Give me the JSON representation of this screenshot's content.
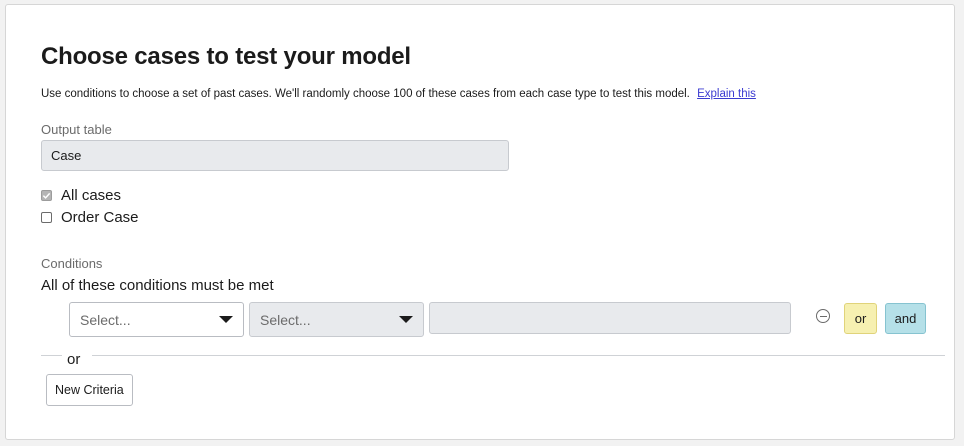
{
  "page": {
    "title": "Choose cases to test your model",
    "description": "Use conditions to choose a set of past cases. We'll randomly choose 100 of these cases from each case type to test this model.",
    "explain_link": "Explain this"
  },
  "output_table": {
    "label": "Output table",
    "value": "Case"
  },
  "case_types": [
    {
      "label": "All cases",
      "checked": true
    },
    {
      "label": "Order Case",
      "checked": false
    }
  ],
  "conditions": {
    "label": "Conditions",
    "heading": "All of these conditions must be met",
    "row": {
      "field_select": "Select...",
      "operator_select": "Select...",
      "value": ""
    },
    "or_button": "or",
    "and_button": "and",
    "or_separator": "or",
    "new_criteria_button": "New Criteria"
  },
  "colors": {
    "or_button_bg": "#f6f0b1",
    "and_button_bg": "#b5e0e8",
    "link": "#3b3bd1"
  }
}
